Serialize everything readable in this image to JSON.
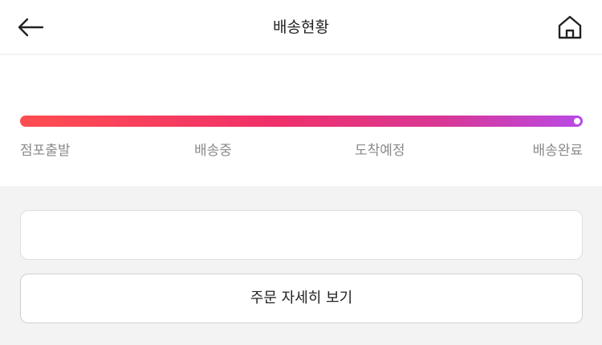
{
  "header": {
    "title": "배송현황",
    "back_icon": "arrow-left-icon",
    "home_icon": "home-icon"
  },
  "tracker": {
    "steps": [
      "점포출발",
      "배송중",
      "도착예정",
      "배송완료"
    ],
    "current_step": "배송완료",
    "progress": 1.0,
    "gradient_colors": [
      "#ff4e50",
      "#f0306a",
      "#d83796",
      "#b94ae6"
    ]
  },
  "actions": {
    "detail_button_label": "주문 자세히 보기"
  },
  "colors": {
    "background_gray": "#f3f3f3",
    "step_text": "#8a8a8a"
  }
}
